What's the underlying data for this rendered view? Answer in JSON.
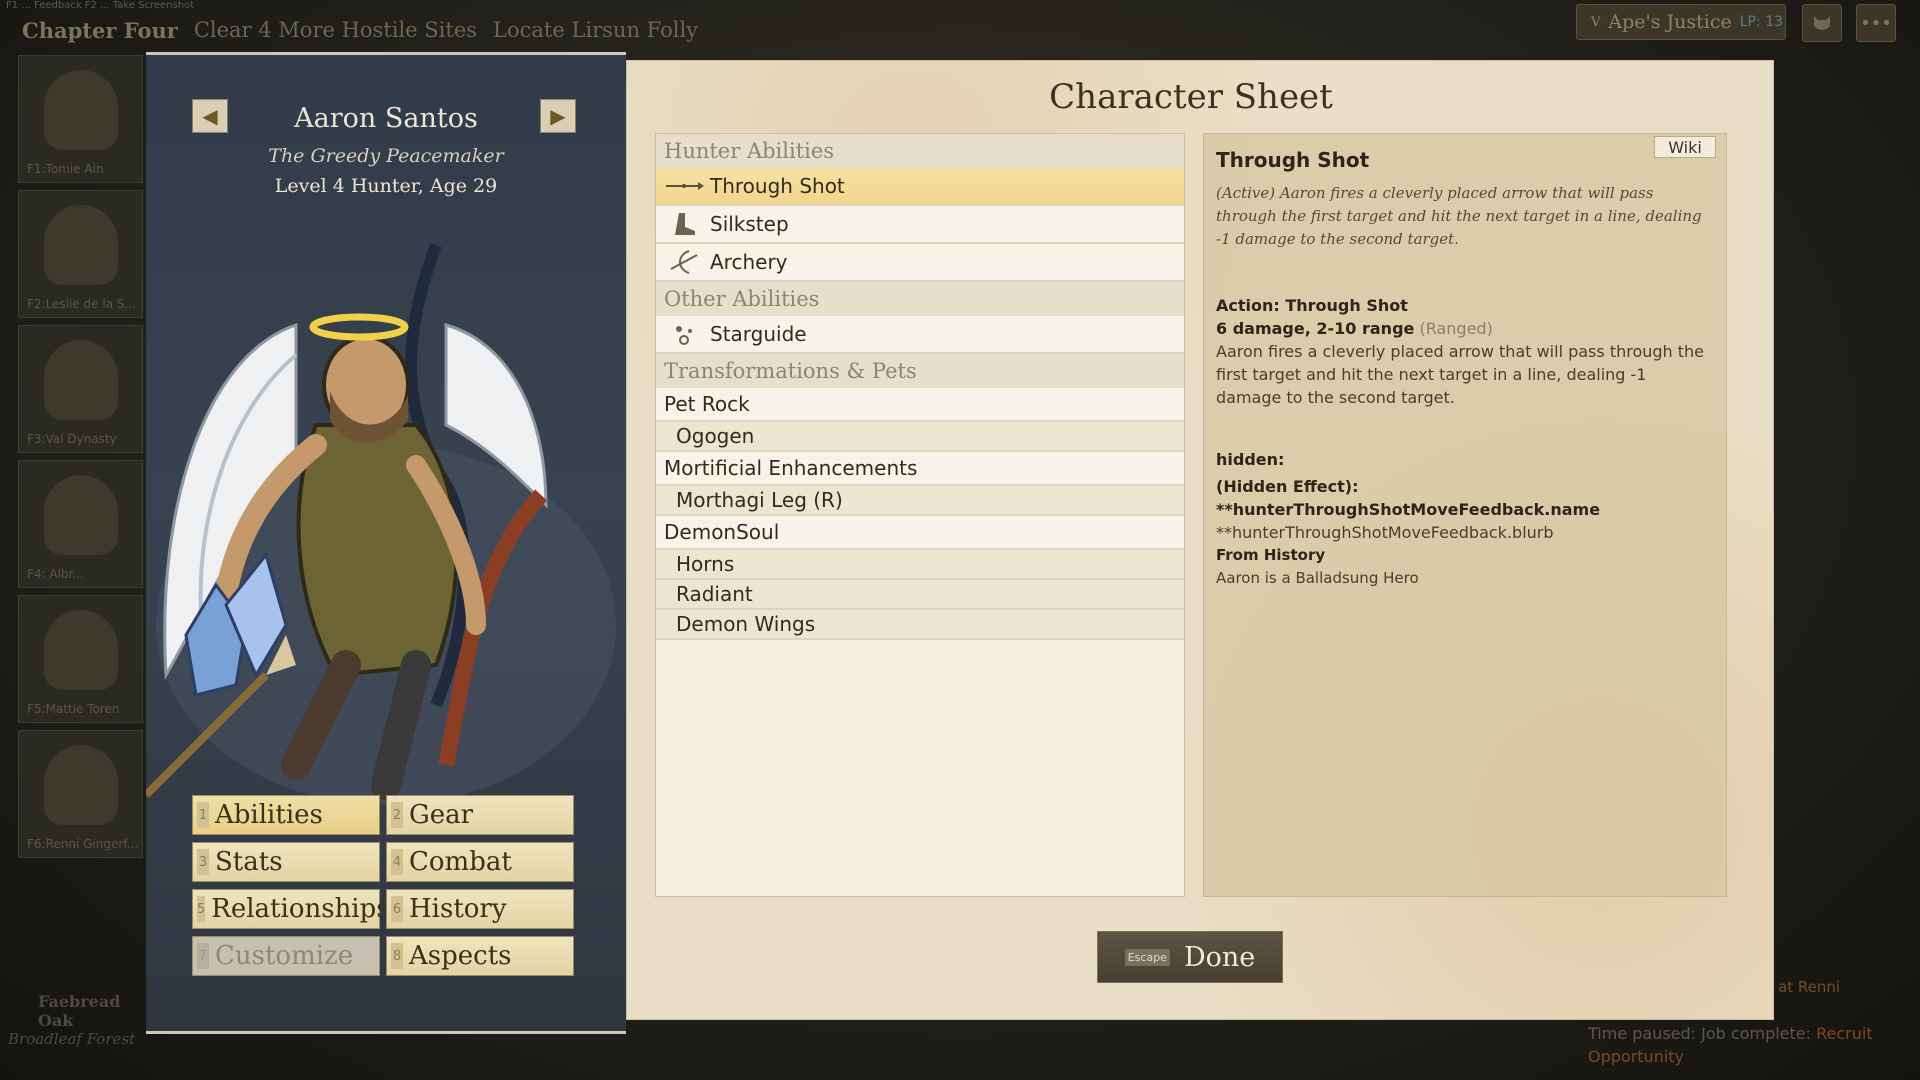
{
  "hud": {
    "topleft_small": "F1 ... Feedback   F2 ... Take Screenshot",
    "chapter": "Chapter Four",
    "quest1": "Clear 4 More Hostile Sites",
    "quest2": "Locate Lirsun Folly",
    "faction_key": "V",
    "faction": "Ape's Justice",
    "lp": "LP: 13",
    "more": "•••",
    "party": [
      "F1:Tomie Ain",
      "F2:Leslie de la S...",
      "F3:Val Dynasty",
      "F4: Albr...",
      "F5:Mattie Toren",
      "F6:Renni Gingerf..."
    ],
    "bottom_left_title": "Faebread Oak",
    "bottom_left_sub": "Broadleaf Forest",
    "renni": "at Renni",
    "status_prefix": "Time paused: Job complete:",
    "status_link": "Recruit Opportunity"
  },
  "character": {
    "name": "Aaron Santos",
    "title": "The Greedy Peacemaker",
    "level_line": "Level 4 Hunter, Age 29",
    "prev": "◀",
    "next": "▶"
  },
  "tabs": [
    {
      "num": "1",
      "label": "Abilities"
    },
    {
      "num": "2",
      "label": "Gear"
    },
    {
      "num": "3",
      "label": "Stats"
    },
    {
      "num": "4",
      "label": "Combat"
    },
    {
      "num": "5",
      "label": "Relationships"
    },
    {
      "num": "6",
      "label": "History"
    },
    {
      "num": "7",
      "label": "Customize"
    },
    {
      "num": "8",
      "label": "Aspects"
    }
  ],
  "sheet": {
    "title": "Character Sheet",
    "sections": {
      "hunter": "Hunter Abilities",
      "other": "Other Abilities",
      "transform": "Transformations & Pets"
    },
    "hunter_abilities": [
      {
        "label": "Through Shot",
        "icon": "arrow-icon"
      },
      {
        "label": "Silkstep",
        "icon": "boot-icon"
      },
      {
        "label": "Archery",
        "icon": "bow-icon"
      }
    ],
    "other_abilities": [
      {
        "label": "Starguide",
        "icon": "stars-icon"
      }
    ],
    "transformations": {
      "pet_rock": "Pet Rock",
      "ogogen": "Ogogen",
      "mortificial": "Mortificial Enhancements",
      "morthagi": "Morthagi Leg (R)",
      "demonsoul": "DemonSoul",
      "horns": "Horns",
      "radiant": "Radiant",
      "demon_wings": "Demon Wings"
    }
  },
  "detail": {
    "wiki": "Wiki",
    "name": "Through Shot",
    "description": "(Active) Aaron fires a cleverly placed arrow that will pass through the first target and hit the next target in a line, dealing -1 damage to the second target.",
    "action_title": "Action: Through Shot",
    "action_stats": "6 damage, 2-10 range",
    "action_type": "(Ranged)",
    "action_body": "Aaron fires a cleverly placed arrow that will pass through the first target and hit the next target in a line, dealing -1 damage to the second target.",
    "hidden_label": "hidden:",
    "hidden_effect_prefix": "(Hidden Effect):",
    "hidden_effect_name": "**hunterThroughShotMoveFeedback.name",
    "hidden_effect_blurb": "**hunterThroughShotMoveFeedback.blurb",
    "history_title": "From History",
    "history_body": "Aaron is a Balladsung Hero"
  },
  "done": {
    "key": "Escape",
    "label": "Done"
  }
}
